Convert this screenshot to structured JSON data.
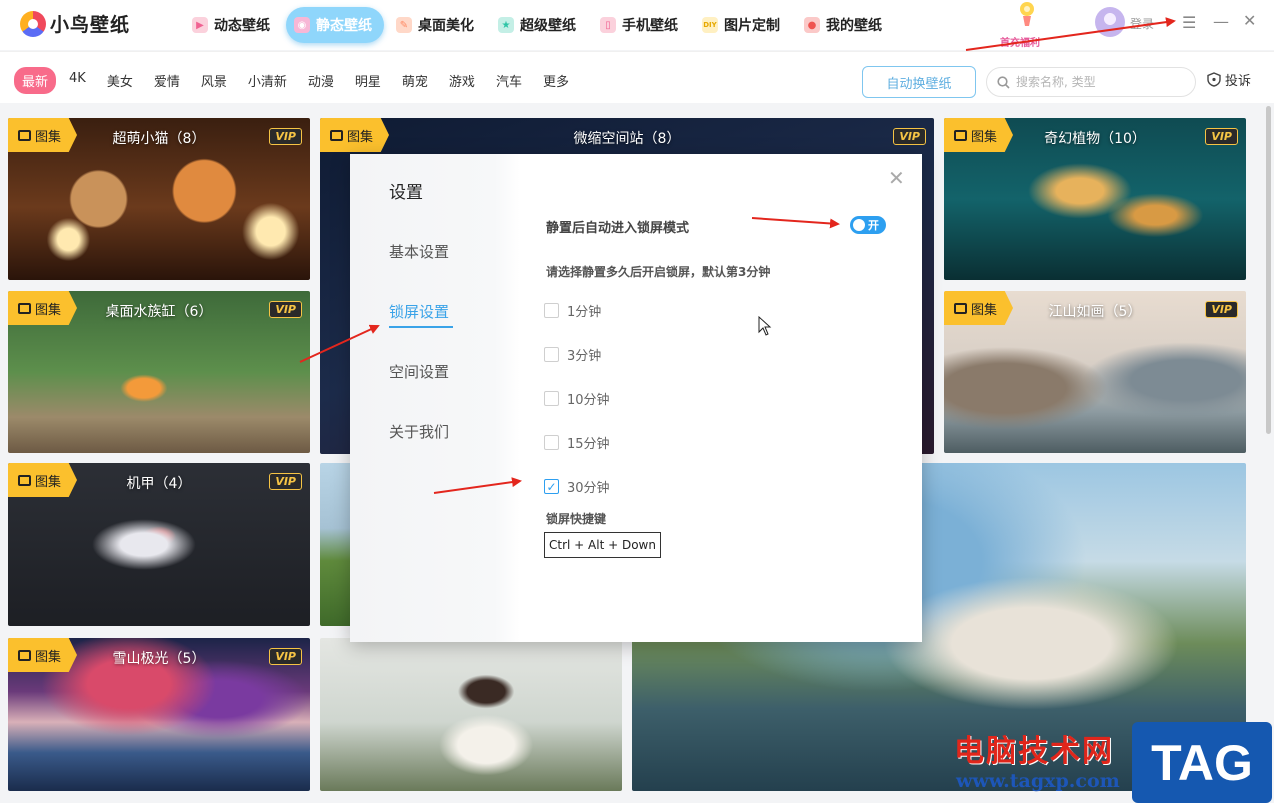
{
  "app": {
    "name": "小鸟壁纸"
  },
  "nav": {
    "items": [
      {
        "label": "动态壁纸",
        "icon": "play-icon",
        "color": "#f06292"
      },
      {
        "label": "静态壁纸",
        "icon": "image-icon",
        "color": "#ec6fa8"
      },
      {
        "label": "桌面美化",
        "icon": "brush-icon",
        "color": "#ff8a65"
      },
      {
        "label": "超级壁纸",
        "icon": "star-icon",
        "color": "#2ec4a6"
      },
      {
        "label": "手机壁纸",
        "icon": "phone-icon",
        "color": "#f06292"
      },
      {
        "label": "图片定制",
        "icon": "diy-icon",
        "color": "#ffca28"
      },
      {
        "label": "我的壁纸",
        "icon": "user-icon",
        "color": "#ef5350"
      }
    ],
    "active_index": 1
  },
  "header": {
    "login": "登录",
    "promo": "首充福利"
  },
  "categories": {
    "items": [
      "最新",
      "4K",
      "美女",
      "爱情",
      "风景",
      "小清新",
      "动漫",
      "明星",
      "萌宠",
      "游戏",
      "汽车",
      "更多"
    ],
    "active_index": 0
  },
  "toolbar": {
    "auto_change": "自动换壁纸",
    "search_placeholder": "搜索名称, 类型",
    "report": "投诉"
  },
  "cards": [
    {
      "badge": "图集",
      "title": "超萌小猫（8）",
      "vip": "VIP"
    },
    {
      "badge": "图集",
      "title": "微缩空间站（8）",
      "vip": "VIP"
    },
    {
      "badge": "图集",
      "title": "奇幻植物（10）",
      "vip": "VIP"
    },
    {
      "badge": "图集",
      "title": "桌面水族缸（6）",
      "vip": "VIP"
    },
    {
      "badge": "图集",
      "title": "江山如画（5）",
      "vip": "VIP"
    },
    {
      "badge": "图集",
      "title": "机甲（4）",
      "vip": "VIP"
    },
    {
      "badge": "图集",
      "title": "雪山极光（5）",
      "vip": "VIP"
    }
  ],
  "dialog": {
    "title": "设置",
    "nav": [
      "基本设置",
      "锁屏设置",
      "空间设置",
      "关于我们"
    ],
    "active_nav": 1,
    "lock_option_label": "静置后自动进入锁屏模式",
    "toggle_on": true,
    "toggle_text": "开",
    "idle_desc": "请选择静置多久后开启锁屏，默认第3分钟",
    "durations": [
      {
        "label": "1分钟",
        "checked": false
      },
      {
        "label": "3分钟",
        "checked": false
      },
      {
        "label": "10分钟",
        "checked": false
      },
      {
        "label": "15分钟",
        "checked": false
      },
      {
        "label": "30分钟",
        "checked": true
      }
    ],
    "hotkey_label": "锁屏快捷键",
    "hotkey_value": "Ctrl + Alt + Down"
  },
  "watermark": {
    "site_name": "电脑技术网",
    "url": "www.tagxp.com",
    "logo": "TAG"
  },
  "colors": {
    "accent": "#2d9ff0",
    "category_active": "#f86b8a",
    "nav_active": "#8fd6fb",
    "vip_gold": "#f6c445",
    "badge_yellow": "#fbc02d",
    "annotation_red": "#e3261d"
  }
}
